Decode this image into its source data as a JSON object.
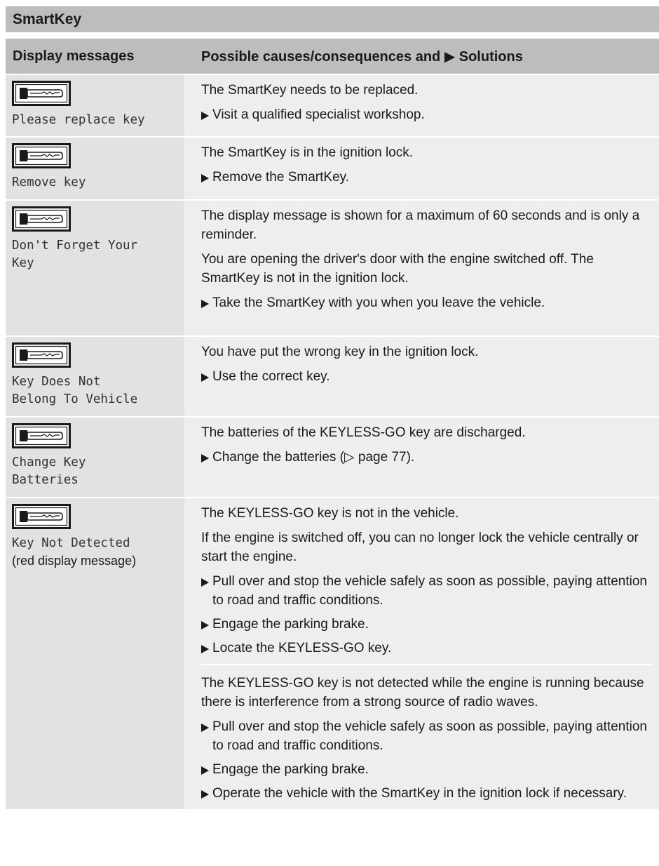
{
  "section_title": "SmartKey",
  "table": {
    "col1_header": "Display messages",
    "col2_header": "Possible causes/consequences and ▶ Solutions"
  },
  "icons": {
    "key": "key-display-icon"
  },
  "rows": [
    {
      "message": "Please replace key",
      "blocks": [
        {
          "paras": [
            "The SmartKey needs to be replaced."
          ],
          "bullets": [
            "Visit a qualified specialist workshop."
          ]
        }
      ]
    },
    {
      "message": "Remove key",
      "blocks": [
        {
          "paras": [
            "The SmartKey is in the ignition lock."
          ],
          "bullets": [
            "Remove the SmartKey."
          ]
        }
      ]
    },
    {
      "message": "Don't Forget Your\nKey",
      "blocks": [
        {
          "paras": [
            "The display message is shown for a maximum of 60 seconds and is only a reminder.",
            "You are opening the driver's door with the engine switched off. The SmartKey is not in the ignition lock."
          ],
          "bullets": [
            "Take the SmartKey with you when you leave the vehicle."
          ]
        }
      ]
    },
    {
      "message": "Key Does Not\nBelong To Vehicle",
      "blocks": [
        {
          "paras": [
            "You have put the wrong key in the ignition lock."
          ],
          "bullets": [
            "Use the correct key."
          ]
        }
      ]
    },
    {
      "message": "Change Key\nBatteries",
      "blocks": [
        {
          "paras": [
            "The batteries of the KEYLESS-GO key are discharged."
          ],
          "bullets": [
            "Change the batteries (▷ page 77)."
          ]
        }
      ]
    },
    {
      "message": "Key Not Detected",
      "note": "(red display message)",
      "blocks": [
        {
          "paras": [
            "The KEYLESS-GO key is not in the vehicle.",
            "If the engine is switched off, you can no longer lock the vehicle centrally or start the engine."
          ],
          "bullets": [
            "Pull over and stop the vehicle safely as soon as possible, paying attention to road and traffic conditions.",
            "Engage the parking brake.",
            "Locate the KEYLESS-GO key."
          ]
        },
        {
          "paras": [
            "The KEYLESS-GO key is not detected while the engine is running because there is interference from a strong source of radio waves."
          ],
          "bullets": [
            "Pull over and stop the vehicle safely as soon as possible, paying attention to road and traffic conditions.",
            "Engage the parking brake.",
            "Operate the vehicle with the SmartKey in the ignition lock if necessary."
          ]
        }
      ]
    }
  ]
}
